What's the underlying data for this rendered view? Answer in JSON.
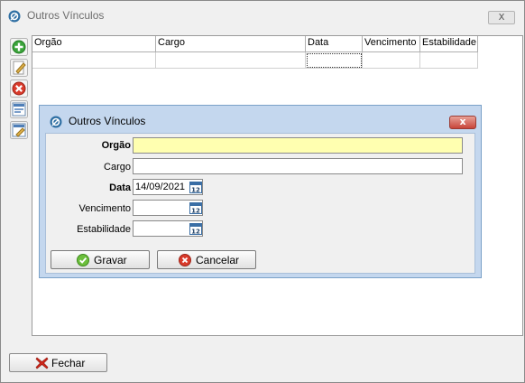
{
  "window": {
    "title": "Outros Vínculos",
    "close_label": "x"
  },
  "toolbar": {
    "icons": [
      "add-icon",
      "edit-icon",
      "delete-icon",
      "list-icon",
      "edit-list-icon"
    ]
  },
  "grid": {
    "columns": [
      "Orgão",
      "Cargo",
      "Data",
      "Vencimento",
      "Estabilidade"
    ]
  },
  "footer": {
    "close_label": "Fechar"
  },
  "dialog": {
    "title": "Outros Vínculos",
    "close_label": "x",
    "fields": {
      "orgao_label": "Orgão",
      "orgao_value": "",
      "cargo_label": "Cargo",
      "cargo_value": "",
      "data_label": "Data",
      "data_value": "14/09/2021",
      "vencimento_label": "Vencimento",
      "vencimento_value": "",
      "estabilidade_label": "Estabilidade",
      "estabilidade_value": ""
    },
    "buttons": {
      "save_label": "Gravar",
      "cancel_label": "Cancelar"
    },
    "calendar_icon_text": "12"
  },
  "colors": {
    "required_field": "#ffffb0",
    "dialog_frame": "#c4d7ee",
    "add_green": "#3aa43a",
    "delete_red": "#d93a2b"
  }
}
